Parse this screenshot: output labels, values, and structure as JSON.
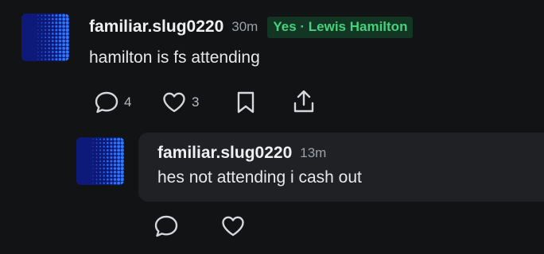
{
  "comment": {
    "username": "familiar.slug0220",
    "time": "30m",
    "badge": "Yes · Lewis Hamilton",
    "text": "hamilton is fs attending",
    "comments_count": "4",
    "likes_count": "3"
  },
  "reply": {
    "username": "familiar.slug0220",
    "time": "13m",
    "text": "hes not attending i cash out"
  },
  "colors": {
    "background": "#111315",
    "badge_bg": "#123524",
    "badge_text": "#46d17c",
    "avatar_bg": "#0e1a7a",
    "avatar_dots": "#2f7bff"
  }
}
